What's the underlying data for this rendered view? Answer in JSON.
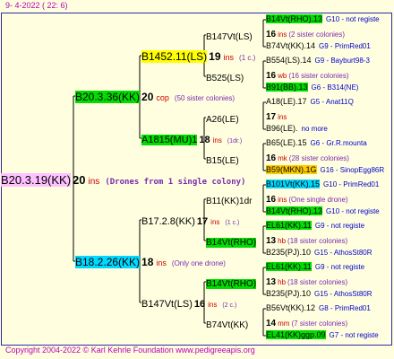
{
  "header": {
    "date": "9-   4-2022 (  22:   6)"
  },
  "footer": {
    "copyright": "Copyright 2004-2022 © Karl Kehrle Foundation    www.pedigreeapis.org"
  },
  "colors": {
    "yellow": "#ffff00",
    "green": "#00dd00",
    "cyan": "#00d8ff",
    "orange": "#ffcc00",
    "pink": "#ffc0ff",
    "red": "#cc0000",
    "magenta": "#b800b8",
    "blue": "#0000cc",
    "teal": "#008888",
    "purple": "#7a28b0",
    "bg": "#ffffe0"
  },
  "nodes": {
    "root": {
      "name": "B20.3.19(KK)",
      "count": "20",
      "suffix": "ins",
      "note": "(Drones from 1 single colony)"
    },
    "p1": {
      "name": "B20.3.36(KK)",
      "count": "20",
      "suffix": "cop",
      "note": "(50 sister colonies)"
    },
    "p2": {
      "name": "B18.2.26(KK)",
      "count": "18",
      "suffix": "ins",
      "note": "(Only one drone)"
    },
    "p1a": {
      "name": "B1452.11(LS)",
      "count": "19",
      "suffix": "ins",
      "note": "(1 c.)"
    },
    "p1b": {
      "name": "A1815(MU)1",
      "count": "18",
      "suffix": "ins",
      "note": "(1dr.)"
    },
    "p2a": {
      "name": "B17.2.8(KK)",
      "count": "17",
      "suffix": "ins",
      "note": "(1 c.)"
    },
    "p2b": {
      "name": "B147Vt(LS)",
      "count": "16",
      "suffix": "ins",
      "note": "(2 c.)"
    },
    "p1a1": {
      "name": "B147Vt(LS)"
    },
    "p1a2": {
      "name": "B525(LS)"
    },
    "p1b1": {
      "name": "A26(LE)"
    },
    "p1b2": {
      "name": "B15(LE)"
    },
    "p2a1": {
      "name": "B11(KK)1dr"
    },
    "p2a2": {
      "name": "B14Vt(RHO)"
    },
    "p2b1": {
      "name": "B14Vt(RHO)"
    },
    "p2b2": {
      "name": "B74Vt(KK)"
    }
  },
  "leaves": [
    {
      "name": "B14Vt(RHO).13",
      "info": "G10 - not registe"
    },
    {
      "count": "16",
      "suffix": "ins",
      "note": "(2 sister colonies)"
    },
    {
      "name": "B74Vt(KK).14",
      "info": "G9 - PrimRed01"
    },
    {
      "name": "B554(LS).14",
      "info": "G9 - Bayburt98-3"
    },
    {
      "count": "16",
      "suffix": "wb",
      "note": "(16 sister colonies)"
    },
    {
      "name": "B91(BB).13",
      "info": "G6 - B314(NE)"
    },
    {
      "name": "A18(LE).17",
      "info": "G5 - Anat11Q"
    },
    {
      "count": "17",
      "suffix": "ins",
      "note": ""
    },
    {
      "name": "B96(LE).",
      "info": "no more"
    },
    {
      "name": "B65(LE).15",
      "info": "G6 - Gr.R.mounta"
    },
    {
      "count": "16",
      "suffix": "mk",
      "note": "(28 sister colonies)"
    },
    {
      "name": "B59(MKN).1G",
      "info": "G16 - SinopEgg86R"
    },
    {
      "name": "B101Vt(KK).15",
      "info": "G10 - PrimRed01"
    },
    {
      "count": "16",
      "suffix": "ins",
      "note": "(One single drone)"
    },
    {
      "name": "B14Vt(RHO).13",
      "info": "G10 - not registe"
    },
    {
      "name": "EL61(KK).11",
      "info": "G9 - not registe"
    },
    {
      "count": "13",
      "suffix": "hb",
      "note": "(18 sister colonies)"
    },
    {
      "name": "B235(PJ).10",
      "info": "G15 - AthosSt80R"
    },
    {
      "name": "EL61(KK).11",
      "info": "G9 - not registe"
    },
    {
      "count": "13",
      "suffix": "hb",
      "note": "(18 sister colonies)"
    },
    {
      "name": "B235(PJ).10",
      "info": "G15 - AthosSt80R"
    },
    {
      "name": "B56Vt(KK).12",
      "info": "G8 - PrimRed01"
    },
    {
      "count": "14",
      "suffix": "mm",
      "note": "(7 sister colonies)"
    },
    {
      "name": "EL41(KK)ggp.09",
      "info": "G7 - not registe"
    }
  ]
}
